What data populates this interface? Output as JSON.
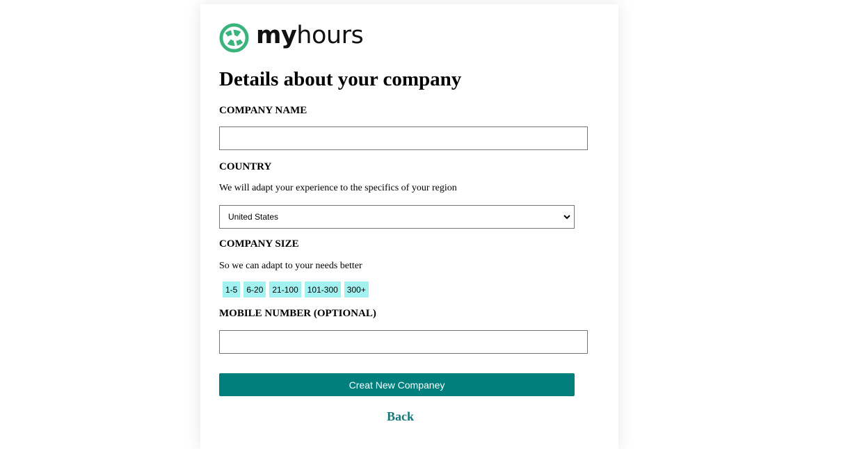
{
  "brand": {
    "logo_bold": "my",
    "logo_light": "hours",
    "logo_icon": "globe-clock-icon",
    "accent_color": "#3bb37d"
  },
  "form": {
    "title": "Details about your company",
    "company_name": {
      "label": "COMPANY NAME",
      "value": ""
    },
    "country": {
      "label": "COUNTRY",
      "helper": "We will adapt your experience to the specifics of your region",
      "selected": "United States"
    },
    "company_size": {
      "label": "COMPANY SIZE",
      "helper": "So we can adapt to your needs better",
      "options": [
        "1-5",
        "6-20",
        "21-100",
        "101-300",
        "300+"
      ],
      "chip_color": "#a3f2f2"
    },
    "mobile": {
      "label": "MOBILE NUMBER (OPTIONAL)",
      "value": ""
    },
    "submit_label": "Creat New Companey",
    "submit_color": "#007f7d",
    "back_label": "Back"
  }
}
